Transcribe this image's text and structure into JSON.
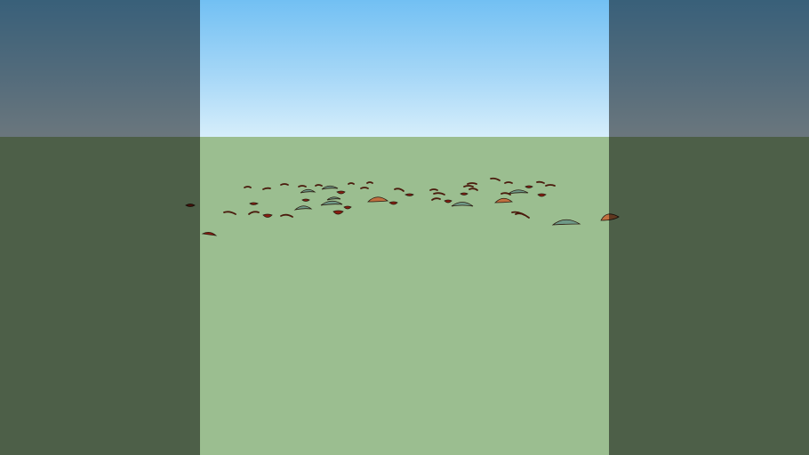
{
  "scene": {
    "description_visible_text": "",
    "palette": {
      "sky_top": "#72c0f3",
      "sky_bottom": "#d6eefb",
      "ground": "#9bbe90",
      "leaf_green": "#6f9a88",
      "leaf_brown": "#c07040",
      "leaf_dark_red": "#8a1e10",
      "leaf_outline": "#2a1a10",
      "side_shade_opacity": 0.5
    },
    "objects": {
      "leaf_types": [
        "green-leaf",
        "brown-leaf",
        "dark-red-leaf",
        "twig"
      ]
    }
  }
}
